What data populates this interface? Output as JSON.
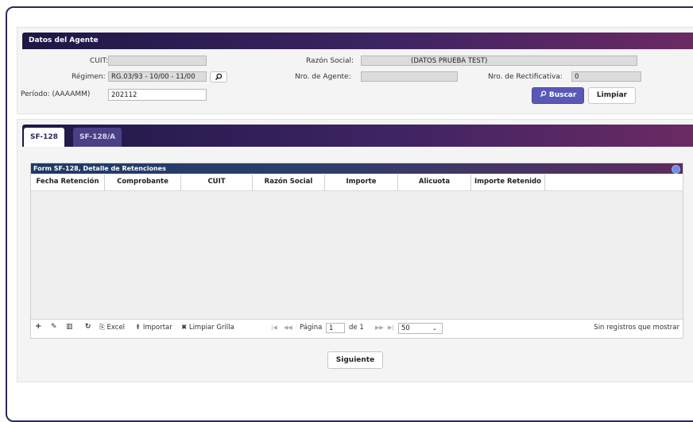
{
  "agent_panel": {
    "title": "Datos del Agente",
    "cuit_label": "CUIT:",
    "cuit_value": "",
    "regimen_label": "Régimen:",
    "regimen_value": "RG.03/93 - 10/00 - 11/00",
    "periodo_label": "Período: (AAAAMM)",
    "periodo_value": "202112",
    "razon_label": "Razón Social:",
    "razon_value": "(DATOS PRUEBA TEST)",
    "nro_agente_label": "Nro. de Agente:",
    "nro_agente_value": "",
    "nro_rect_label": "Nro. de Rectificativa:",
    "nro_rect_value": "0",
    "buscar_label": "Buscar",
    "limpiar_label": "Limpiar"
  },
  "tabs": [
    {
      "label": "SF-128",
      "active": true
    },
    {
      "label": "SF-128/A",
      "active": false
    }
  ],
  "grid": {
    "title": "Form SF-128, Detalle de Retenciones",
    "columns": [
      "Fecha Retención",
      "Comprobante",
      "CUIT",
      "Razón Social",
      "Importe",
      "Alicuota",
      "Importe Retenido"
    ],
    "rows": []
  },
  "toolbar": {
    "add_icon": "plus-icon",
    "edit_icon": "pencil-icon",
    "delete_icon": "trash-icon",
    "refresh_icon": "refresh-icon",
    "excel_label": "Excel",
    "importar_label": "Importar",
    "limpiar_grilla_label": "Limpiar Grilla"
  },
  "pager": {
    "pagina_label": "Página",
    "page_value": "1",
    "de_label": "de 1",
    "page_size": "50",
    "status_text": "Sin registros que mostrar"
  },
  "siguiente_label": "Siguiente",
  "colors": {
    "header_gradient_start": "#1e1845",
    "header_gradient_end": "#6c2a63",
    "primary_button": "#5a58b6"
  }
}
